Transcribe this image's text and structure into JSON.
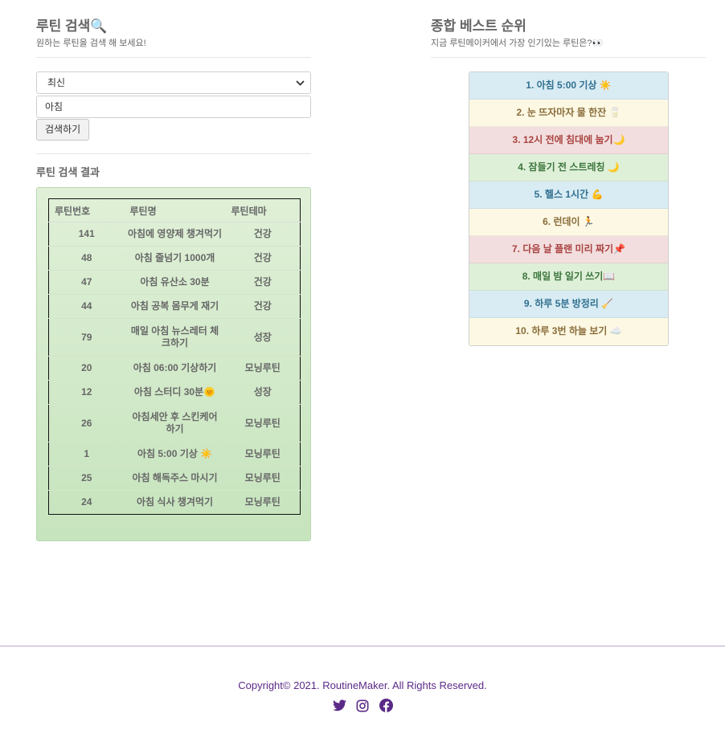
{
  "search": {
    "title": "루틴 검색🔍",
    "subtitle": "원하는 루틴을 검색 해 보세요!",
    "sort_selected": "최신",
    "query_value": "아침",
    "button_label": "검색하기"
  },
  "results": {
    "title": "루틴 검색 결과",
    "columns": [
      "루틴번호",
      "루틴명",
      "루틴테마"
    ],
    "rows": [
      [
        "141",
        "아침에 영양제 챙겨먹기",
        "건강"
      ],
      [
        "48",
        "아침 줄넘기 1000개",
        "건강"
      ],
      [
        "47",
        "아침 유산소 30분",
        "건강"
      ],
      [
        "44",
        "아침 공복 몸무게 재기",
        "건강"
      ],
      [
        "79",
        "매일 아침 뉴스레터 체크하기",
        "성장"
      ],
      [
        "20",
        "아침 06:00 기상하기",
        "모닝루틴"
      ],
      [
        "12",
        "아침 스터디 30분🌞",
        "성장"
      ],
      [
        "26",
        "아침세안 후 스킨케어 하기",
        "모닝루틴"
      ],
      [
        "1",
        "아침 5:00 기상 ☀️",
        "모닝루틴"
      ],
      [
        "25",
        "아침 해독주스 마시기",
        "모닝루틴"
      ],
      [
        "24",
        "아침 식사 챙겨먹기",
        "모닝루틴"
      ]
    ]
  },
  "best": {
    "title": "종합 베스트 순위",
    "subtitle": "지금 루틴메이커에서 가장 인기있는 루틴은?👀",
    "items": [
      "1. 아침 5:00 기상 ☀️",
      "2. 눈 뜨자마자 물 한잔 🥛",
      "3. 12시 전에 침대에 눕기🌙",
      "4. 잠들기 전 스트레칭 🌙",
      "5. 헬스 1시간 💪",
      "6. 런데이 🏃",
      "7. 다음 날 플랜 미리 짜기📌",
      "8. 매일 밤 일기 쓰기📖",
      "9. 하루 5분 방정리 🧹",
      "10. 하루 3번 하늘 보기 ☁️"
    ],
    "item_styles": [
      "info",
      "warning",
      "danger",
      "success",
      "info",
      "warning",
      "danger",
      "success",
      "info",
      "warning"
    ]
  },
  "footer": {
    "copyright": "Copyright© 2021. RoutineMaker. All Rights Reserved.",
    "social_icons": [
      "twitter-icon",
      "instagram-icon",
      "facebook-icon"
    ],
    "icon_color": "#5b2a86"
  }
}
